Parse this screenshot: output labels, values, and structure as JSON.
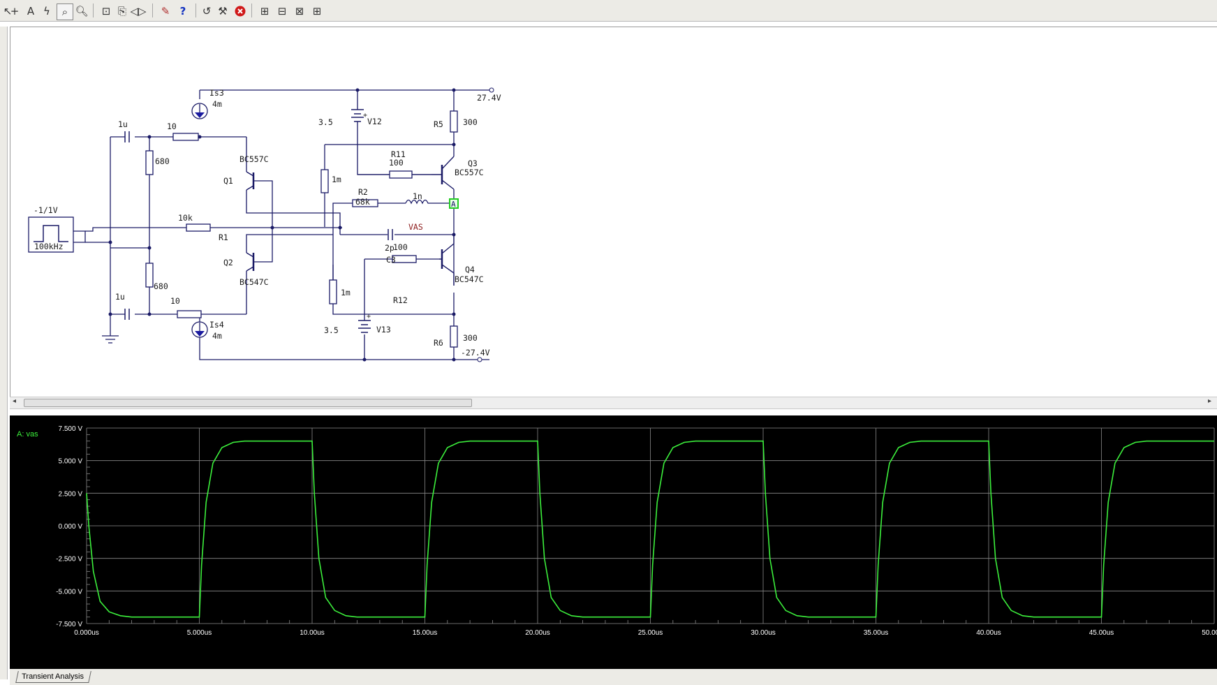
{
  "toolbar": {
    "items": [
      "pointer-tool",
      "wire-tool",
      "text-tool",
      "probe-tool",
      "zoom-area-tool",
      "zoom-tool",
      "zoom-fit",
      "zoom-page",
      "mirror",
      "plot-toggle",
      "help",
      "undo",
      "properties",
      "stop-simulation",
      "toolbox-1",
      "toolbox-2",
      "toolbox-3",
      "toolbox-4"
    ]
  },
  "schematic": {
    "labels": {
      "is3": "Is3",
      "is3_val": "4m",
      "is4": "Is4",
      "is4_val": "4m",
      "c_in_top": "1u",
      "r_top": "10",
      "r_680_top": "680",
      "c_in_bot": "1u",
      "r_bot": "10",
      "r_680_bot": "680",
      "source_amp": "-1/1V",
      "source_freq": "100kHz",
      "r1_val": "10k",
      "r1": "R1",
      "q1": "Q1",
      "q1_type": "BC557C",
      "q2": "Q2",
      "q2_type": "BC547C",
      "v12_val": "3.5",
      "v12": "V12",
      "v13_val": "3.5",
      "v13": "V13",
      "plus": "+",
      "r5": "R5",
      "r5_val": "300",
      "r6": "R6",
      "r6_val": "300",
      "rail_pos": "27.4V",
      "rail_neg": "-27.4V",
      "r11": "R11",
      "r11_val": "100",
      "r12": "R12",
      "r12_val": "100",
      "r_1m_top": "1m",
      "r_1m_bot": "1m",
      "r2": "R2",
      "r2_val": "68k",
      "l_val": "1n",
      "vas": "VAS",
      "c3": "C3",
      "c3_val": "2p",
      "q3": "Q3",
      "q3_type": "BC557C",
      "q4": "Q4",
      "q4_type": "BC547C",
      "probe": "A"
    }
  },
  "scope": {
    "trace_label": "A: vas",
    "y_ticks": [
      "7.500 V",
      "5.000 V",
      "2.500 V",
      "0.000 V",
      "-2.500 V",
      "-5.000 V",
      "-7.500 V"
    ],
    "x_ticks": [
      "0.000us",
      "5.000us",
      "10.00us",
      "15.00us",
      "20.00us",
      "25.00us",
      "30.00us",
      "35.00us",
      "40.00us",
      "45.00us",
      "50.00us"
    ]
  },
  "chart_data": {
    "type": "line",
    "title": "",
    "xlabel": "",
    "ylabel": "",
    "xlim": [
      0,
      50
    ],
    "ylim": [
      -7.5,
      7.5
    ],
    "grid": true,
    "series": [
      {
        "name": "A: vas",
        "color": "#3cf03c",
        "x": [
          0,
          0.1,
          0.3,
          0.6,
          1.0,
          1.5,
          2.0,
          5.0,
          5.1,
          5.3,
          5.6,
          6.0,
          6.5,
          7.0,
          10.0,
          10.1,
          10.3,
          10.6,
          11.0,
          11.5,
          12.0,
          15.0,
          15.1,
          15.3,
          15.6,
          16.0,
          16.5,
          17.0,
          20.0,
          20.1,
          20.3,
          20.6,
          21.0,
          21.5,
          22.0,
          25.0,
          25.1,
          25.3,
          25.6,
          26.0,
          26.5,
          27.0,
          30.0,
          30.1,
          30.3,
          30.6,
          31.0,
          31.5,
          32.0,
          35.0,
          35.1,
          35.3,
          35.6,
          36.0,
          36.5,
          37.0,
          40.0,
          40.1,
          40.3,
          40.6,
          41.0,
          41.5,
          42.0,
          45.0,
          45.1,
          45.3,
          45.6,
          46.0,
          46.5,
          47.0,
          50.0
        ],
        "values": [
          2.5,
          0.0,
          -3.5,
          -5.8,
          -6.6,
          -6.9,
          -7.0,
          -7.0,
          -3.0,
          1.8,
          4.8,
          6.0,
          6.4,
          6.5,
          6.5,
          2.5,
          -2.5,
          -5.5,
          -6.5,
          -6.9,
          -7.0,
          -7.0,
          -3.0,
          1.8,
          4.8,
          6.0,
          6.4,
          6.5,
          6.5,
          2.5,
          -2.5,
          -5.5,
          -6.5,
          -6.9,
          -7.0,
          -7.0,
          -3.0,
          1.8,
          4.8,
          6.0,
          6.4,
          6.5,
          6.5,
          2.5,
          -2.5,
          -5.5,
          -6.5,
          -6.9,
          -7.0,
          -7.0,
          -3.0,
          1.8,
          4.8,
          6.0,
          6.4,
          6.5,
          6.5,
          2.5,
          -2.5,
          -5.5,
          -6.5,
          -6.9,
          -7.0,
          -7.0,
          -3.0,
          1.8,
          4.8,
          6.0,
          6.4,
          6.5,
          6.5
        ]
      }
    ]
  },
  "tabs": {
    "active": "Transient Analysis"
  }
}
